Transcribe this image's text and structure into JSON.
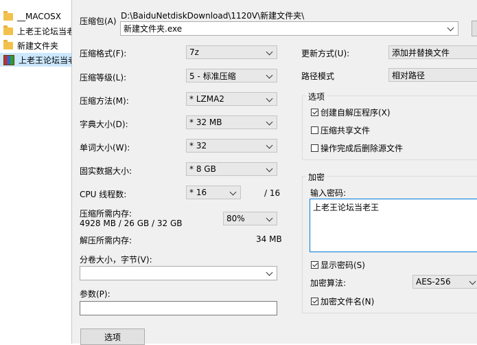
{
  "explorer": {
    "files": [
      {
        "name": "__MACOSX",
        "type": "folder"
      },
      {
        "name": "上老王论坛当老",
        "type": "folder"
      },
      {
        "name": "新建文件夹",
        "type": "folder"
      },
      {
        "name": "上老王论坛当老",
        "type": "archive"
      }
    ]
  },
  "archive": {
    "label": "压缩包(A)",
    "path": "D:\\BaiduNetdiskDownload\\1120V\\新建文件夹\\",
    "filename": "新建文件夹.exe"
  },
  "left": {
    "format": {
      "label": "压缩格式(F):",
      "value": "7z"
    },
    "level": {
      "label": "压缩等级(L):",
      "value": "5 - 标准压缩"
    },
    "method": {
      "label": "压缩方法(M):",
      "value": "* LZMA2"
    },
    "dictionary": {
      "label": "字典大小(D):",
      "value": "* 32 MB"
    },
    "word": {
      "label": "单词大小(W):",
      "value": "* 32"
    },
    "solid": {
      "label": "固实数据大小:",
      "value": "* 8 GB"
    },
    "threads": {
      "label": "CPU 线程数:",
      "value": "* 16",
      "total": "/ 16"
    },
    "memory": {
      "label": "压缩所需内存:",
      "detail": "4928 MB / 26 GB / 32 GB",
      "percent": "80%"
    },
    "decompress": {
      "label": "解压所需内存:",
      "value": "34 MB"
    },
    "split": {
      "label": "分卷大小，字节(V):",
      "value": ""
    },
    "params": {
      "label": "参数(P):",
      "value": ""
    },
    "options_button": "选项"
  },
  "right": {
    "update": {
      "label": "更新方式(U):",
      "value": "添加并替换文件"
    },
    "pathmode": {
      "label": "路径模式",
      "value": "相对路径"
    },
    "options": {
      "title": "选项",
      "sfx": "创建自解压程序(X)",
      "shared": "压缩共享文件",
      "delete": "操作完成后删除源文件"
    },
    "encryption": {
      "title": "加密",
      "password_label": "输入密码:",
      "password_value": "上老王论坛当老王",
      "show_password": "显示密码(S)",
      "method_label": "加密算法:",
      "method_value": "AES-256",
      "encrypt_names": "加密文件名(N)"
    }
  }
}
